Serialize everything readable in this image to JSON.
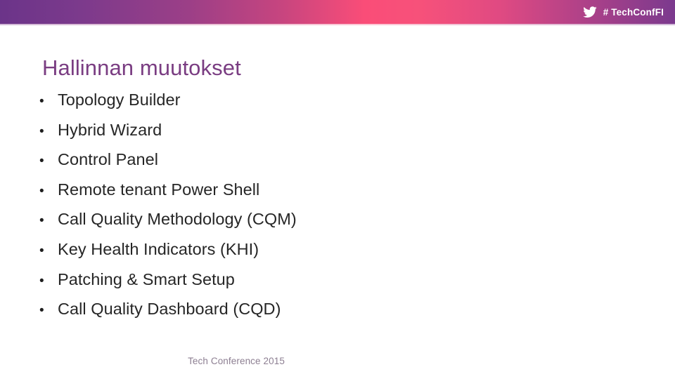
{
  "header": {
    "twitter_icon": "twitter-bird-icon",
    "hashtag": "# TechConfFI"
  },
  "title": "Hallinnan muutokset",
  "bullets": [
    {
      "marker": "•",
      "label": "Topology Builder"
    },
    {
      "marker": "•",
      "label": "Hybrid Wizard"
    },
    {
      "marker": "•",
      "label": "Control Panel"
    },
    {
      "marker": "•",
      "label": "Remote tenant Power Shell"
    },
    {
      "marker": "•",
      "label": "Call Quality Methodology (CQM)"
    },
    {
      "marker": "•",
      "label": "Key Health Indicators (KHI)"
    },
    {
      "marker": "•",
      "label": "Patching & Smart Setup"
    },
    {
      "marker": "•",
      "label": "Call Quality Dashboard (CQD)"
    }
  ],
  "footer": "Tech Conference 2015",
  "colors": {
    "title": "#7a3d82",
    "body_text": "#262626",
    "footer_text": "#8d7f92",
    "band_purple_left": "#6b3489",
    "band_pink_center": "#fa4d78",
    "band_purple_right": "#7b3a8e",
    "background": "#ffffff"
  }
}
